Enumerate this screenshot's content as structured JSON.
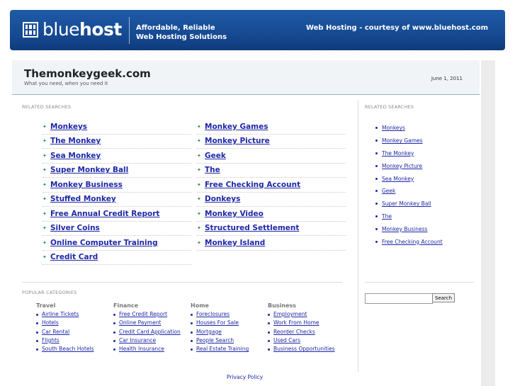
{
  "banner": {
    "brand_light": "blue",
    "brand_bold": "host",
    "tagline_line1": "Affordable, Reliable",
    "tagline_line2": "Web Hosting Solutions",
    "courtesy": "Web Hosting - courtesy of www.bluehost.com"
  },
  "header": {
    "title": "Themonkeygeek.com",
    "subtitle": "What you need, when you need it",
    "date": "June 1, 2011"
  },
  "related_label": "RELATED SEARCHES",
  "main_links_left": [
    "Monkeys",
    "The Monkey",
    "Sea Monkey",
    "Super Monkey Ball",
    "Monkey Business",
    "Stuffed Monkey",
    "Free Annual Credit Report",
    "Silver Coins",
    "Online Computer Training",
    "Credit Card"
  ],
  "main_links_right": [
    "Monkey Games",
    "Monkey Picture",
    "Geek",
    "The",
    "Free Checking Account",
    "Donkeys",
    "Monkey Video",
    "Structured Settlement",
    "Monkey Island"
  ],
  "sidebar_label": "RELATED SEARCHES",
  "sidebar_links": [
    "Monkeys",
    "Monkey Games",
    "The Monkey",
    "Monkey Picture",
    "Sea Monkey",
    "Geek",
    "Super Monkey Ball",
    "The",
    "Monkey Business",
    "Free Checking Account"
  ],
  "popular_label": "POPULAR CATEGORIES",
  "categories": [
    {
      "title": "Travel",
      "items": [
        "Airline Tickets",
        "Hotels",
        "Car Rental",
        "Flights",
        "South Beach Hotels"
      ]
    },
    {
      "title": "Finance",
      "items": [
        "Free Credit Report",
        "Online Payment",
        "Credit Card Application",
        "Car Insurance",
        "Health Insurance"
      ]
    },
    {
      "title": "Home",
      "items": [
        "Foreclosures",
        "Houses For Sale",
        "Mortgage",
        "People Search",
        "Real Estate Training"
      ]
    },
    {
      "title": "Business",
      "items": [
        "Employment",
        "Work From Home",
        "Reorder Checks",
        "Used Cars",
        "Business Opportunities"
      ]
    }
  ],
  "search": {
    "button_label": "Search",
    "value": ""
  },
  "footer": {
    "privacy": "Privacy Policy"
  },
  "colors": {
    "banner": "#164a92",
    "link": "#1f28a6",
    "arrow": "#2b8a3e",
    "header_bg": "#f1f4f6"
  }
}
